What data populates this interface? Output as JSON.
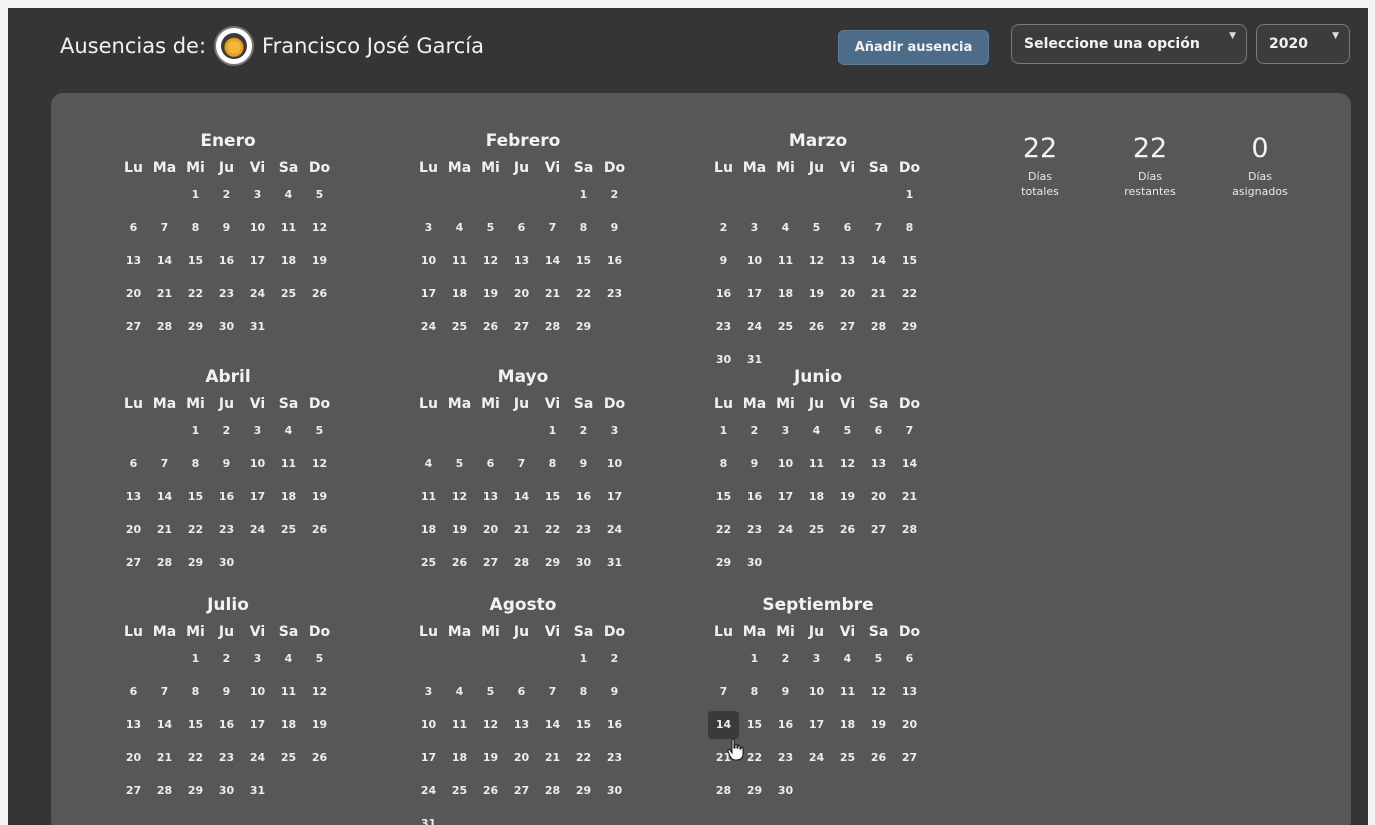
{
  "header": {
    "title_label": "Ausencias de:",
    "user_name": "Francisco José García",
    "add_button": "Añadir ausencia",
    "option_select": "Seleccione una opción",
    "year_select": "2020"
  },
  "stats": [
    {
      "value": "22",
      "label": "Días\ntotales"
    },
    {
      "value": "22",
      "label": "Días\nrestantes"
    },
    {
      "value": "0",
      "label": "Días\nasignados"
    }
  ],
  "weekdays": [
    "Lu",
    "Ma",
    "Mi",
    "Ju",
    "Vi",
    "Sa",
    "Do"
  ],
  "months": [
    {
      "name": "Enero",
      "offset": 2,
      "days": 31
    },
    {
      "name": "Febrero",
      "offset": 5,
      "days": 29
    },
    {
      "name": "Marzo",
      "offset": 6,
      "days": 31
    },
    {
      "name": "Abril",
      "offset": 2,
      "days": 30
    },
    {
      "name": "Mayo",
      "offset": 4,
      "days": 31
    },
    {
      "name": "Junio",
      "offset": 0,
      "days": 30
    },
    {
      "name": "Julio",
      "offset": 2,
      "days": 31
    },
    {
      "name": "Agosto",
      "offset": 5,
      "days": 31
    },
    {
      "name": "Septiembre",
      "offset": 1,
      "days": 30
    }
  ],
  "hovered_day": {
    "month": "Septiembre",
    "day": 14
  },
  "colors": {
    "background": "#353535",
    "panel": "#575757",
    "button": "#4d6c8a"
  }
}
